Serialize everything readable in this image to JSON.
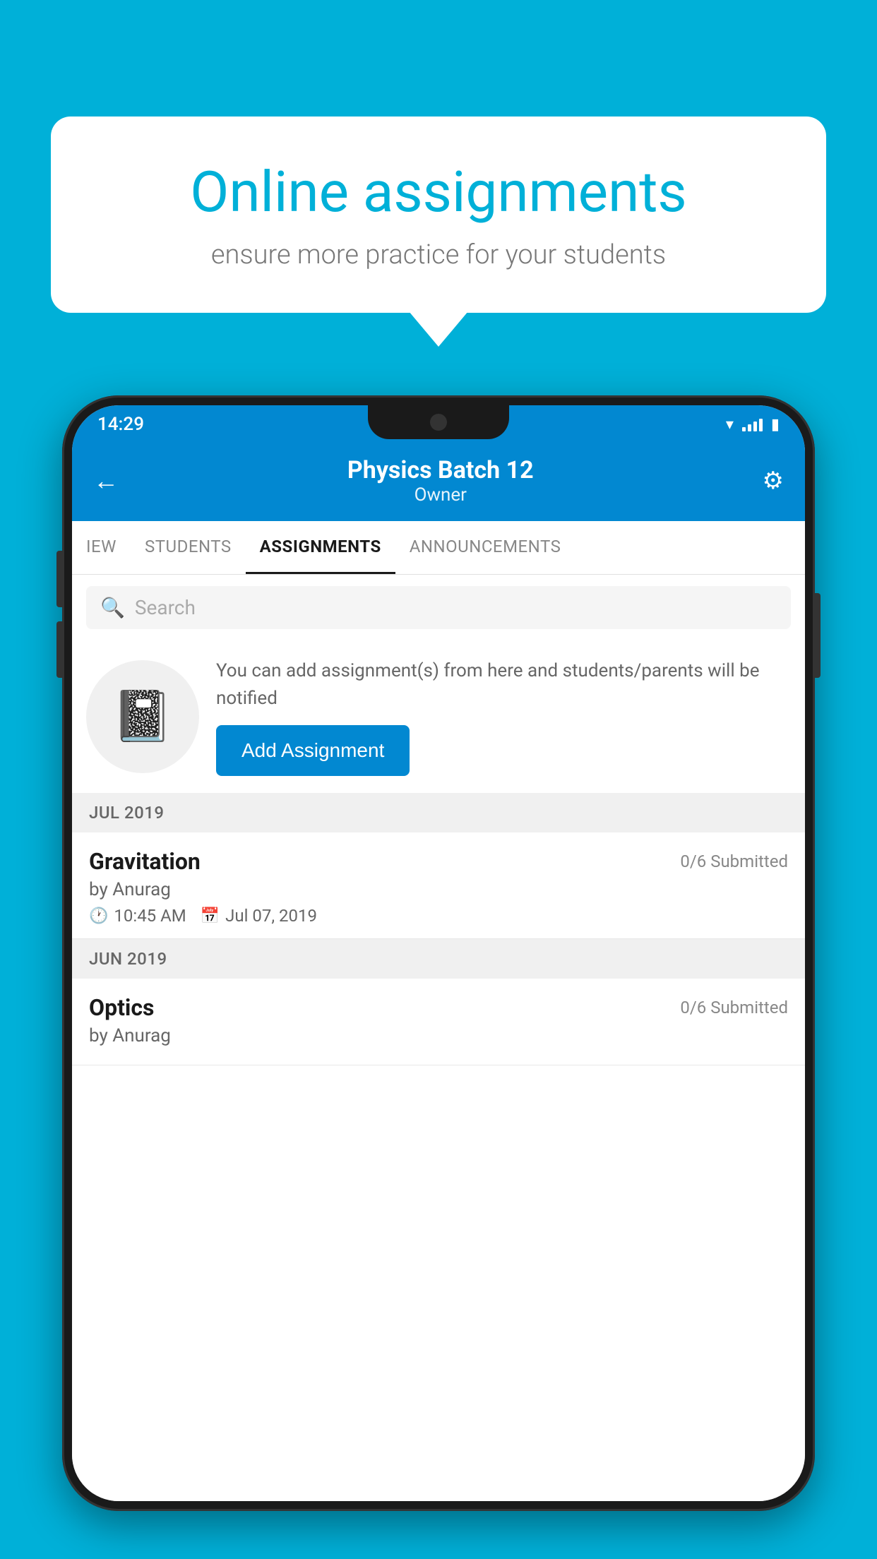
{
  "background_color": "#00B0D8",
  "speech_bubble": {
    "title": "Online assignments",
    "subtitle": "ensure more practice for your students"
  },
  "status_bar": {
    "time": "14:29",
    "icons": [
      "wifi",
      "signal",
      "battery"
    ]
  },
  "app_header": {
    "title": "Physics Batch 12",
    "subtitle": "Owner",
    "back_label": "←",
    "settings_label": "⚙"
  },
  "tabs": [
    {
      "label": "IEW",
      "active": false
    },
    {
      "label": "STUDENTS",
      "active": false
    },
    {
      "label": "ASSIGNMENTS",
      "active": true
    },
    {
      "label": "ANNOUNCEMENTS",
      "active": false
    }
  ],
  "search": {
    "placeholder": "Search"
  },
  "promo": {
    "text": "You can add assignment(s) from here and students/parents will be notified",
    "button_label": "Add Assignment"
  },
  "sections": [
    {
      "label": "JUL 2019",
      "assignments": [
        {
          "title": "Gravitation",
          "submitted": "0/6 Submitted",
          "by": "by Anurag",
          "time": "10:45 AM",
          "date": "Jul 07, 2019"
        }
      ]
    },
    {
      "label": "JUN 2019",
      "assignments": [
        {
          "title": "Optics",
          "submitted": "0/6 Submitted",
          "by": "by Anurag",
          "time": "",
          "date": ""
        }
      ]
    }
  ]
}
